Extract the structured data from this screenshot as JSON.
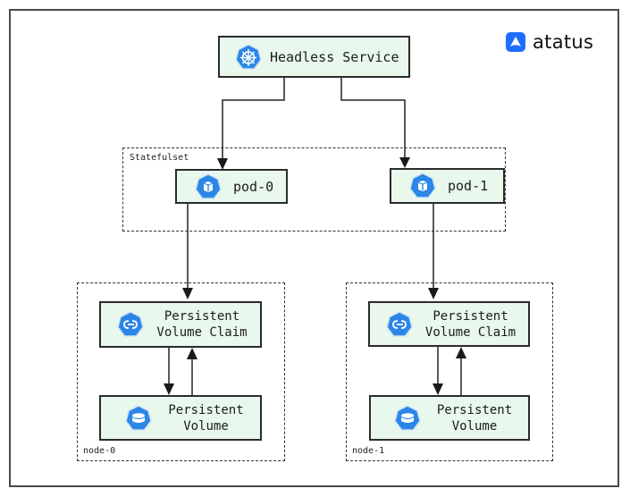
{
  "brand": {
    "name": "atatus",
    "icon": "atatus-logo-icon",
    "color": "#1f6fff"
  },
  "colors": {
    "node_fill": "#e8f8ec",
    "k8s_blue": "#2b86e6",
    "line": "#222222"
  },
  "nodes": {
    "headless_service": {
      "label": "Headless Service",
      "icon": "kubernetes-wheel-icon"
    },
    "pod_0": {
      "label": "pod-0",
      "icon": "pod-icon"
    },
    "pod_1": {
      "label": "pod-1",
      "icon": "pod-icon"
    },
    "pvc_0": {
      "line1": "Persistent",
      "line2": "Volume Claim",
      "icon": "pvc-icon"
    },
    "pv_0": {
      "line1": "Persistent",
      "line2": "Volume",
      "icon": "pv-icon"
    },
    "pvc_1": {
      "line1": "Persistent",
      "line2": "Volume Claim",
      "icon": "pvc-icon"
    },
    "pv_1": {
      "line1": "Persistent",
      "line2": "Volume",
      "icon": "pv-icon"
    }
  },
  "groups": {
    "statefulset": "Statefulset",
    "node_0": "node-0",
    "node_1": "node-1"
  },
  "edges": [
    {
      "from": "headless_service",
      "to": "pod_0"
    },
    {
      "from": "headless_service",
      "to": "pod_1"
    },
    {
      "from": "pod_0",
      "to": "pvc_0"
    },
    {
      "from": "pod_1",
      "to": "pvc_1"
    },
    {
      "from": "pvc_0",
      "to": "pv_0"
    },
    {
      "from": "pv_0",
      "to": "pvc_0"
    },
    {
      "from": "pvc_1",
      "to": "pv_1"
    },
    {
      "from": "pv_1",
      "to": "pvc_1"
    }
  ]
}
